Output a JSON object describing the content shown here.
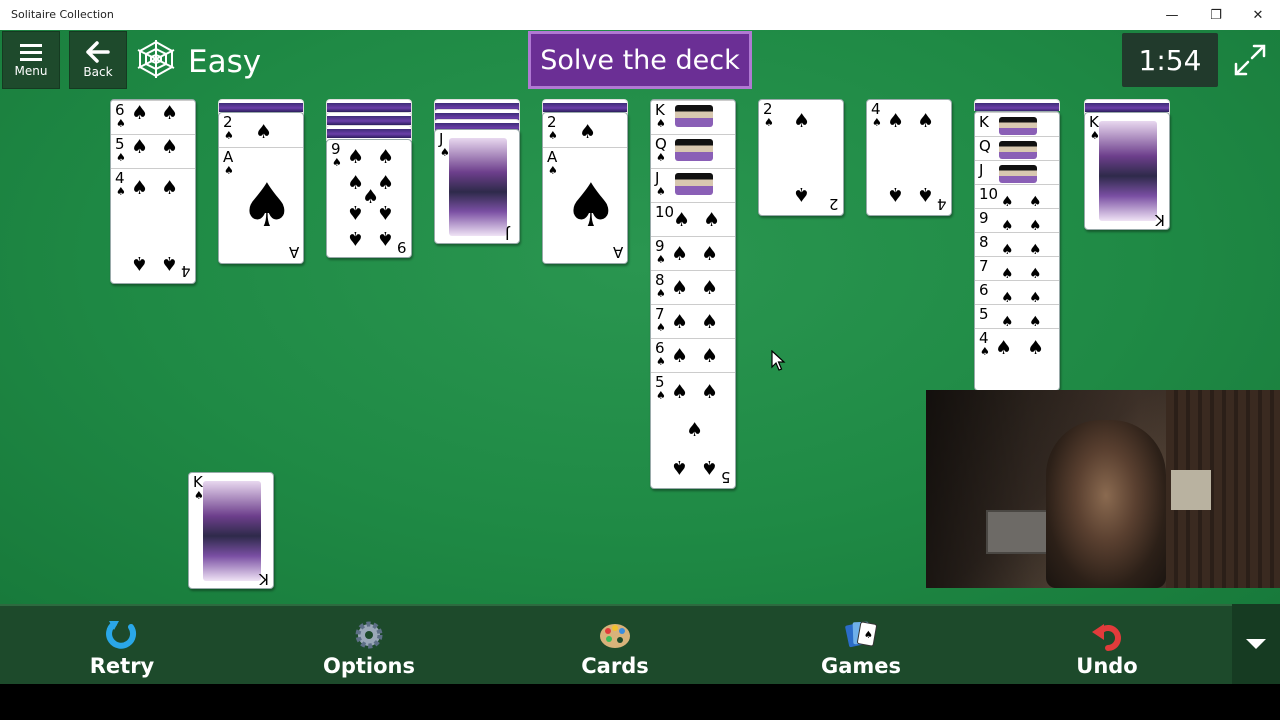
{
  "window": {
    "title": "Solitaire Collection",
    "controls": {
      "minimize": "—",
      "restore": "❐",
      "close": "✕"
    }
  },
  "toolbar": {
    "menu_label": "Menu",
    "back_label": "Back",
    "difficulty": "Easy",
    "challenge": "Solve the deck",
    "timer": "1:54"
  },
  "tableau": [
    {
      "hidden": 0,
      "cards": [
        "6♠",
        "5♠",
        "4♠"
      ]
    },
    {
      "hidden": 1,
      "cards": [
        "2♠",
        "A♠"
      ]
    },
    {
      "hidden": 3,
      "cards": [
        "9♠"
      ]
    },
    {
      "hidden": 3,
      "cards": [
        "J♠"
      ]
    },
    {
      "hidden": 1,
      "cards": [
        "2♠",
        "A♠"
      ]
    },
    {
      "hidden": 0,
      "cards": [
        "K♠",
        "Q♠",
        "J♠",
        "10♠",
        "9♠",
        "8♠",
        "7♠",
        "6♠",
        "5♠"
      ]
    },
    {
      "hidden": 0,
      "cards": [
        "2♠"
      ]
    },
    {
      "hidden": 0,
      "cards": [
        "4♠"
      ]
    },
    {
      "hidden": 1,
      "cards": [
        "K♠",
        "Q♠",
        "J♠",
        "10♠",
        "9♠",
        "8♠",
        "7♠",
        "6♠",
        "5♠",
        "4♠"
      ]
    },
    {
      "hidden": 1,
      "cards": [
        "K♠"
      ]
    }
  ],
  "stock": {
    "card": "K♠"
  },
  "card_text": {
    "c1": [
      "6",
      "5",
      "4"
    ],
    "c2": [
      "2",
      "A"
    ],
    "c3": [
      "9"
    ],
    "c4": [
      "J"
    ],
    "c5": [
      "2",
      "A"
    ],
    "c6": [
      "K",
      "Q",
      "J",
      "10",
      "9",
      "8",
      "7",
      "6",
      "5"
    ],
    "c7": [
      "2"
    ],
    "c8": [
      "4"
    ],
    "c9": [
      "K",
      "Q",
      "J",
      "10",
      "9",
      "8",
      "7",
      "6",
      "5",
      "4"
    ],
    "c10": [
      "K"
    ],
    "stock": [
      "K"
    ],
    "suit": "♠"
  },
  "bottombar": {
    "retry": "Retry",
    "options": "Options",
    "cards": "Cards",
    "games": "Games",
    "undo": "Undo"
  },
  "icons": {
    "menu": "hamburger-icon",
    "back": "arrow-left-icon",
    "spider": "spider-web-icon",
    "fullscreen": "expand-icon",
    "retry": "retry-icon",
    "options": "gear-icon",
    "cards": "palette-icon",
    "games": "cards-icon",
    "undo": "undo-icon",
    "more": "chevron-down-icon"
  },
  "colors": {
    "felt": "#1f8a45",
    "challenge": "#6b2f95",
    "timer_bg": "#213a2c",
    "bottom_bar": "#1d4a2b"
  }
}
